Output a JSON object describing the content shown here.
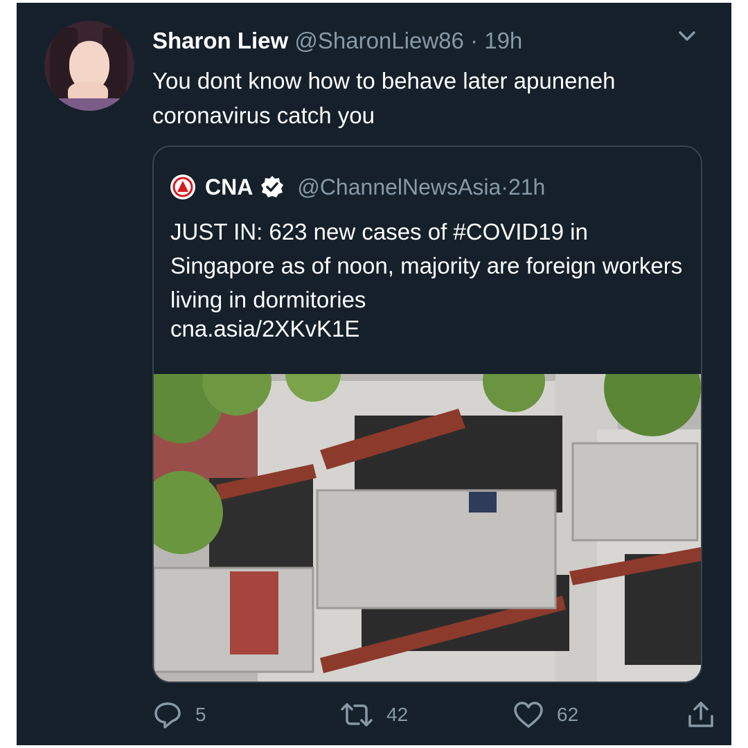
{
  "tweet": {
    "author_name": "Sharon Liew",
    "handle": "@SharonLiew86",
    "time": "19h",
    "text": "You dont know how to behave later apuneneh coronavirus catch you"
  },
  "quoted": {
    "author_name": "CNA",
    "handle": "@ChannelNewsAsia",
    "time": "21h",
    "text": "JUST IN: 623 new cases of #COVID19 in Singapore as of noon, majority are foreign workers living in dormitories",
    "link": "cna.asia/2XKvK1E"
  },
  "actions": {
    "replies": "5",
    "retweets": "42",
    "likes": "62"
  },
  "icons": [
    "chevron-down-icon",
    "verified-icon",
    "reply-icon",
    "retweet-icon",
    "like-icon",
    "share-icon"
  ],
  "colors": {
    "background": "#15202b",
    "secondary_text": "#8899a6",
    "border": "#38444d"
  }
}
